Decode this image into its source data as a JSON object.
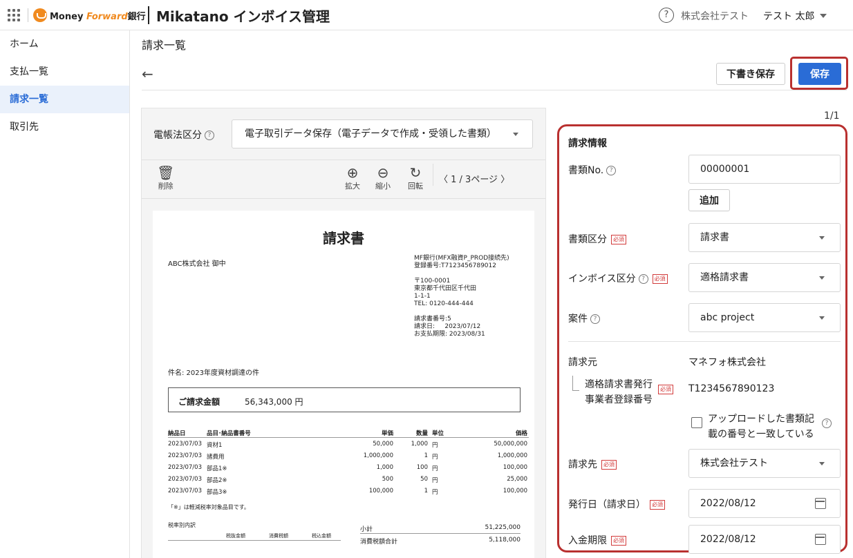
{
  "topbar": {
    "brand": "Money Forward",
    "brand_prefix": "Money ",
    "brand_accent": "Forward",
    "brand_suffix": "銀行",
    "product": "Mikatano インボイス管理",
    "help_glyph": "?",
    "company": "株式会社テスト",
    "user": "テスト 太郎"
  },
  "sidebar": {
    "items": [
      {
        "label": "ホーム"
      },
      {
        "label": "支払一覧"
      },
      {
        "label": "請求一覧"
      },
      {
        "label": "取引先"
      }
    ],
    "active_index": 2
  },
  "page": {
    "title": "請求一覧",
    "back_glyph": "←",
    "draft_label": "下書き保存",
    "save_label": "保存"
  },
  "viewer": {
    "law_label": "電帳法区分",
    "law_value": "電子取引データ保存（電子データで作成・受領した書類）",
    "tools": {
      "delete": "削除",
      "zoom_in": "拡大",
      "zoom_out": "縮小",
      "rotate": "回転"
    },
    "pager": "〈   1 / 3ページ   〉"
  },
  "document": {
    "title": "請求書",
    "to": "ABC株式会社 御中",
    "issuer": "MF銀行(MFX融資P_PROD接続先)\n登録番号:T7123456789012\n\n〒100-0001\n東京都千代田区千代田\n1-1-1\nTEL: 0120-444-444\n\n請求書番号:5\n請求日:     2023/07/12\nお支払期限: 2023/08/31",
    "subject": "件名: 2023年度資材調達の件",
    "amount_label": "ご請求金額",
    "amount_value": "56,343,000 円",
    "table_headers": {
      "date": "納品日",
      "item": "品目･納品書番号",
      "unit_price": "単価",
      "qty": "数量",
      "unit": "単位",
      "price": "価格"
    },
    "rows": [
      {
        "date": "2023/07/03",
        "item": "資材1",
        "unit_price": "50,000",
        "qty": "1,000",
        "unit": "円",
        "price": "50,000,000"
      },
      {
        "date": "2023/07/03",
        "item": "諸費用",
        "unit_price": "1,000,000",
        "qty": "1",
        "unit": "円",
        "price": "1,000,000"
      },
      {
        "date": "2023/07/03",
        "item": "部品1※",
        "unit_price": "1,000",
        "qty": "100",
        "unit": "円",
        "price": "100,000"
      },
      {
        "date": "2023/07/03",
        "item": "部品2※",
        "unit_price": "500",
        "qty": "50",
        "unit": "円",
        "price": "25,000"
      },
      {
        "date": "2023/07/03",
        "item": "部品3※",
        "unit_price": "100,000",
        "qty": "1",
        "unit": "円",
        "price": "100,000"
      }
    ],
    "note": "「※」は軽減税率対象品目です。",
    "tax_title": "税率別内訳",
    "tax_headers": {
      "before": "税抜金額",
      "tax": "消費税額",
      "after": "税込金額"
    },
    "subtotal_label": "小計",
    "subtotal_value": "51,225,000",
    "tax_total_label": "消費税額合計",
    "tax_total_value": "5,118,000"
  },
  "panel": {
    "count": "1/1",
    "title": "請求情報",
    "required_badge": "必須",
    "doc_no_label": "書類No.",
    "doc_no_value": "00000001",
    "add_label": "追加",
    "doc_type_label": "書類区分",
    "doc_type_value": "請求書",
    "invoice_type_label": "インボイス区分",
    "invoice_type_value": "適格請求書",
    "project_label": "案件",
    "project_value": "abc project",
    "issuer_label": "請求元",
    "issuer_value": "マネフォ株式会社",
    "reg_label": "適格請求書発行\n事業者登録番号",
    "reg_value": "T1234567890123",
    "match_label": "アップロードした書類記\n載の番号と一致している",
    "billto_label": "請求先",
    "billto_value": "株式会社テスト",
    "issue_date_label": "発行日（請求日）",
    "issue_date_value": "2022/08/12",
    "due_date_label": "入金期限",
    "due_date_value": "2022/08/12"
  }
}
